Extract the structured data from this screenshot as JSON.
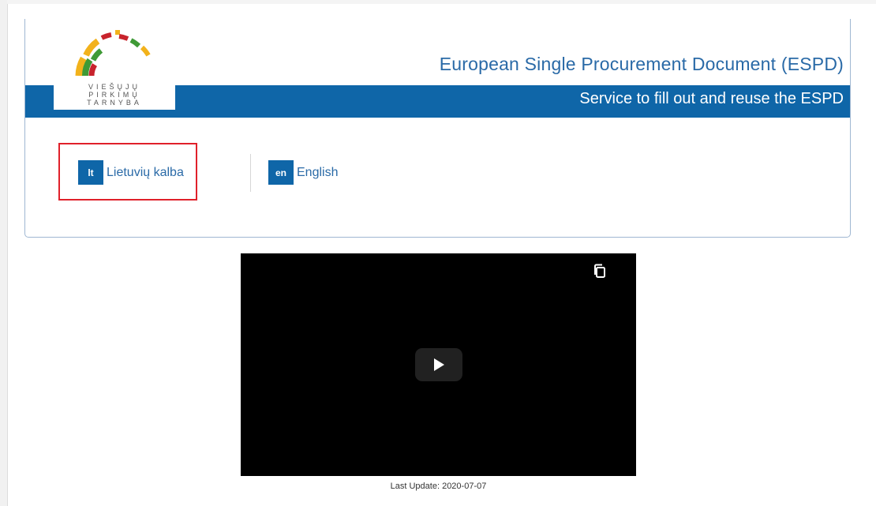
{
  "header": {
    "title": "European Single Procurement Document (ESPD)",
    "subtitle": "Service to fill out and reuse the ESPD",
    "logo": {
      "line1": "VIEŠŲJŲ",
      "line2": "PIRKIMŲ",
      "line3": "TARNYBA",
      "colors": [
        "#f2b21b",
        "#3f9a36",
        "#c8232c",
        "#f2b21b",
        "#3f9a36"
      ]
    }
  },
  "languages": [
    {
      "code": "lt",
      "label": "Lietuvių kalba",
      "highlighted": true
    },
    {
      "code": "en",
      "label": "English",
      "highlighted": false
    }
  ],
  "video": {
    "play_icon": "play-icon",
    "copy_icon": "copy-icon"
  },
  "footer": {
    "last_update": "Last Update: 2020-07-07"
  },
  "colors": {
    "brand_blue": "#0f66a8",
    "title_blue": "#2a6aa7",
    "highlight_red": "#e0202a"
  }
}
